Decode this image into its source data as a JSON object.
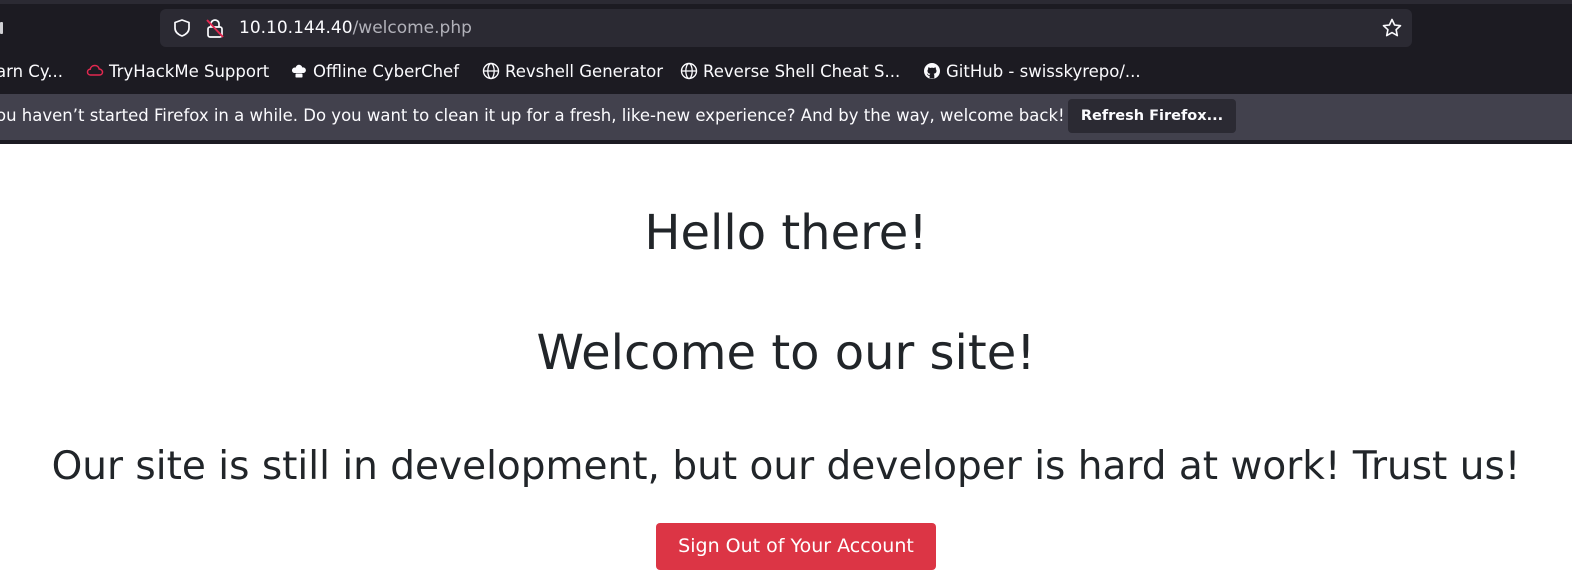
{
  "browser": {
    "url": {
      "host": "10.10.144.40",
      "path": "/welcome.php"
    },
    "bookmarks": [
      {
        "label": "arn Cy...",
        "icon": "none"
      },
      {
        "label": "TryHackMe Support",
        "icon": "cloud-icon"
      },
      {
        "label": "Offline CyberChef",
        "icon": "chef-hat-icon"
      },
      {
        "label": "Revshell Generator",
        "icon": "globe-icon"
      },
      {
        "label": "Reverse Shell Cheat S...",
        "icon": "globe-icon"
      },
      {
        "label": "GitHub - swisskyrepo/...",
        "icon": "github-icon"
      }
    ],
    "notification": {
      "message": "ou haven’t started Firefox in a while. Do you want to clean it up for a fresh, like-new experience? And by the way, welcome back!",
      "button_label": "Refresh Firefox..."
    },
    "colors": {
      "toolbar": "#1c1b22",
      "urlbar": "#2b2a33",
      "notification": "#42414d",
      "lock_warning": "#e22850"
    }
  },
  "page": {
    "heading1": "Hello there!",
    "heading2": "Welcome to our site!",
    "subheading": "Our site is still in development, but our developer is hard at work! Trust us!",
    "signout_button": "Sign Out of Your Account",
    "colors": {
      "text": "#212529",
      "button": "#dc3545"
    }
  }
}
